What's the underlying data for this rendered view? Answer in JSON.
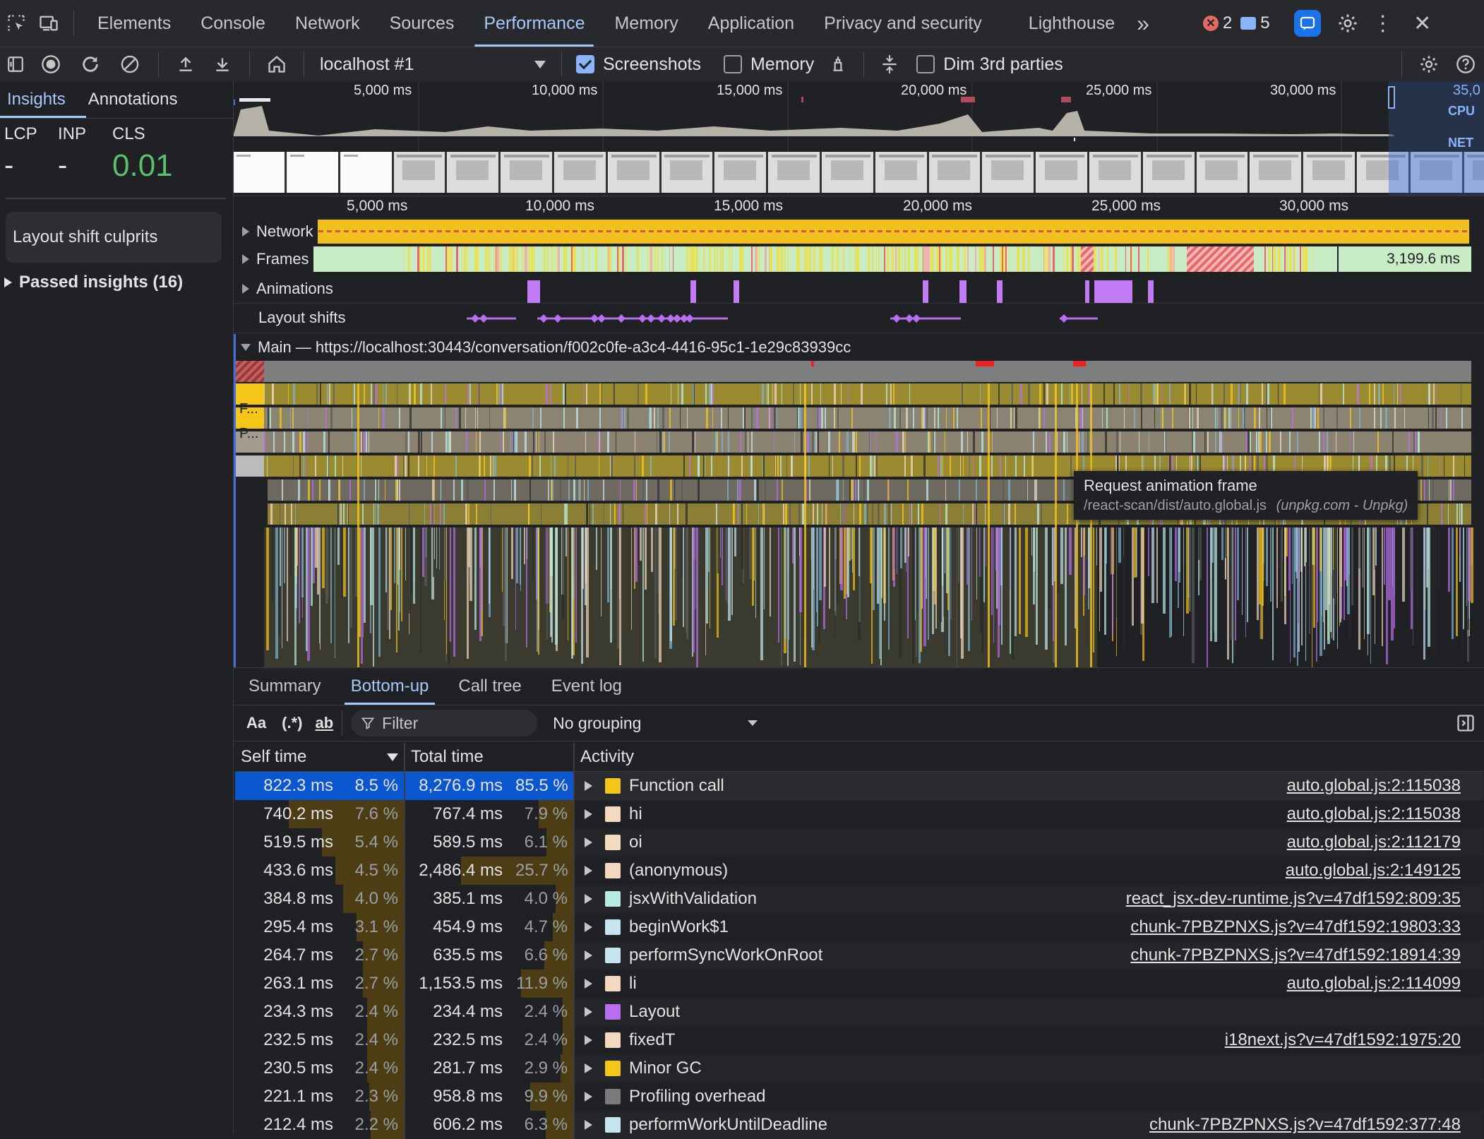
{
  "tabbar": {
    "tabs": [
      "Elements",
      "Console",
      "Network",
      "Sources",
      "Performance",
      "Memory",
      "Application",
      "Privacy and security",
      "Lighthouse"
    ],
    "active": "Performance",
    "more": "»",
    "errors_count": "2",
    "messages_count": "5"
  },
  "toolbar": {
    "target": "localhost #1",
    "screenshots_label": "Screenshots",
    "screenshots_checked": true,
    "memory_label": "Memory",
    "memory_checked": false,
    "dim_label": "Dim 3rd parties",
    "dim_checked": false
  },
  "sidebar": {
    "tabs": [
      "Insights",
      "Annotations"
    ],
    "active_tab": "Insights",
    "metrics": [
      {
        "name": "LCP",
        "value": "-"
      },
      {
        "name": "INP",
        "value": "-"
      },
      {
        "name": "CLS",
        "value": "0.01"
      }
    ],
    "layout_shift_culprits": "Layout shift culprits",
    "passed_insights": "Passed insights (16)"
  },
  "overview": {
    "ticks": [
      "5,000 ms",
      "10,000 ms",
      "15,000 ms",
      "20,000 ms",
      "25,000 ms",
      "30,000 ms",
      "35,0"
    ],
    "cpu_label": "CPU",
    "net_label": "NET"
  },
  "timeline": {
    "ticks": [
      "5,000 ms",
      "10,000 ms",
      "15,000 ms",
      "20,000 ms",
      "25,000 ms",
      "30,000 ms"
    ],
    "tracks": {
      "network": "Network",
      "frames": "Frames",
      "frames_value": "3,199.6 ms",
      "animations": "Animations",
      "layout_shifts": "Layout shifts"
    },
    "main_title": "Main — https://localhost:30443/conversation/f002c0fe-a3c4-4416-95c1-1e29c83939cc",
    "flame_labels": [
      "F...",
      "P..."
    ],
    "tooltip": {
      "title": "Request animation frame",
      "path": "/react-scan/dist/auto.global.js",
      "origin": "(unpkg.com - Unpkg)"
    }
  },
  "bottom": {
    "tabs": [
      "Summary",
      "Bottom-up",
      "Call tree",
      "Event log"
    ],
    "active_tab": "Bottom-up",
    "filter_placeholder": "Filter",
    "grouping": "No grouping",
    "columns": {
      "self": "Self time",
      "total": "Total time",
      "activity": "Activity"
    },
    "rows": [
      {
        "self": "822.3 ms",
        "self_pct": "8.5 %",
        "total": "8,276.9 ms",
        "total_pct": "85.5 %",
        "name": "Function call",
        "color": "#f5c518",
        "url": "auto.global.js:2:115038"
      },
      {
        "self": "740.2 ms",
        "self_pct": "7.6 %",
        "total": "767.4 ms",
        "total_pct": "7.9 %",
        "name": "hi",
        "color": "#f2d9bf",
        "url": "auto.global.js:2:115038"
      },
      {
        "self": "519.5 ms",
        "self_pct": "5.4 %",
        "total": "589.5 ms",
        "total_pct": "6.1 %",
        "name": "oi",
        "color": "#f2d9bf",
        "url": "auto.global.js:2:112179"
      },
      {
        "self": "433.6 ms",
        "self_pct": "4.5 %",
        "total": "2,486.4 ms",
        "total_pct": "25.7 %",
        "name": "(anonymous)",
        "color": "#f2d9bf",
        "url": "auto.global.js:2:149125"
      },
      {
        "self": "384.8 ms",
        "self_pct": "4.0 %",
        "total": "385.1 ms",
        "total_pct": "4.0 %",
        "name": "jsxWithValidation",
        "color": "#b8ece3",
        "url": "react_jsx-dev-runtime.js?v=47df1592:809:35"
      },
      {
        "self": "295.4 ms",
        "self_pct": "3.1 %",
        "total": "454.9 ms",
        "total_pct": "4.7 %",
        "name": "beginWork$1",
        "color": "#c5e4ee",
        "url": "chunk-7PBZPNXS.js?v=47df1592:19803:33"
      },
      {
        "self": "264.7 ms",
        "self_pct": "2.7 %",
        "total": "635.5 ms",
        "total_pct": "6.6 %",
        "name": "performSyncWorkOnRoot",
        "color": "#c5e4ee",
        "url": "chunk-7PBZPNXS.js?v=47df1592:18914:39"
      },
      {
        "self": "263.1 ms",
        "self_pct": "2.7 %",
        "total": "1,153.5 ms",
        "total_pct": "11.9 %",
        "name": "li",
        "color": "#f2d9bf",
        "url": "auto.global.js:2:114099"
      },
      {
        "self": "234.3 ms",
        "self_pct": "2.4 %",
        "total": "234.4 ms",
        "total_pct": "2.4 %",
        "name": "Layout",
        "color": "#b86ef0",
        "url": ""
      },
      {
        "self": "232.5 ms",
        "self_pct": "2.4 %",
        "total": "232.5 ms",
        "total_pct": "2.4 %",
        "name": "fixedT",
        "color": "#f2d9bf",
        "url": "i18next.js?v=47df1592:1975:20"
      },
      {
        "self": "230.5 ms",
        "self_pct": "2.4 %",
        "total": "281.7 ms",
        "total_pct": "2.9 %",
        "name": "Minor GC",
        "color": "#f5c518",
        "url": ""
      },
      {
        "self": "221.1 ms",
        "self_pct": "2.3 %",
        "total": "958.8 ms",
        "total_pct": "9.9 %",
        "name": "Profiling overhead",
        "color": "#7a7a7a",
        "url": ""
      },
      {
        "self": "212.4 ms",
        "self_pct": "2.2 %",
        "total": "606.2 ms",
        "total_pct": "6.3 %",
        "name": "performWorkUntilDeadline",
        "color": "#c5e4ee",
        "url": "chunk-7PBZPNXS.js?v=47df1592:377:48"
      }
    ]
  }
}
